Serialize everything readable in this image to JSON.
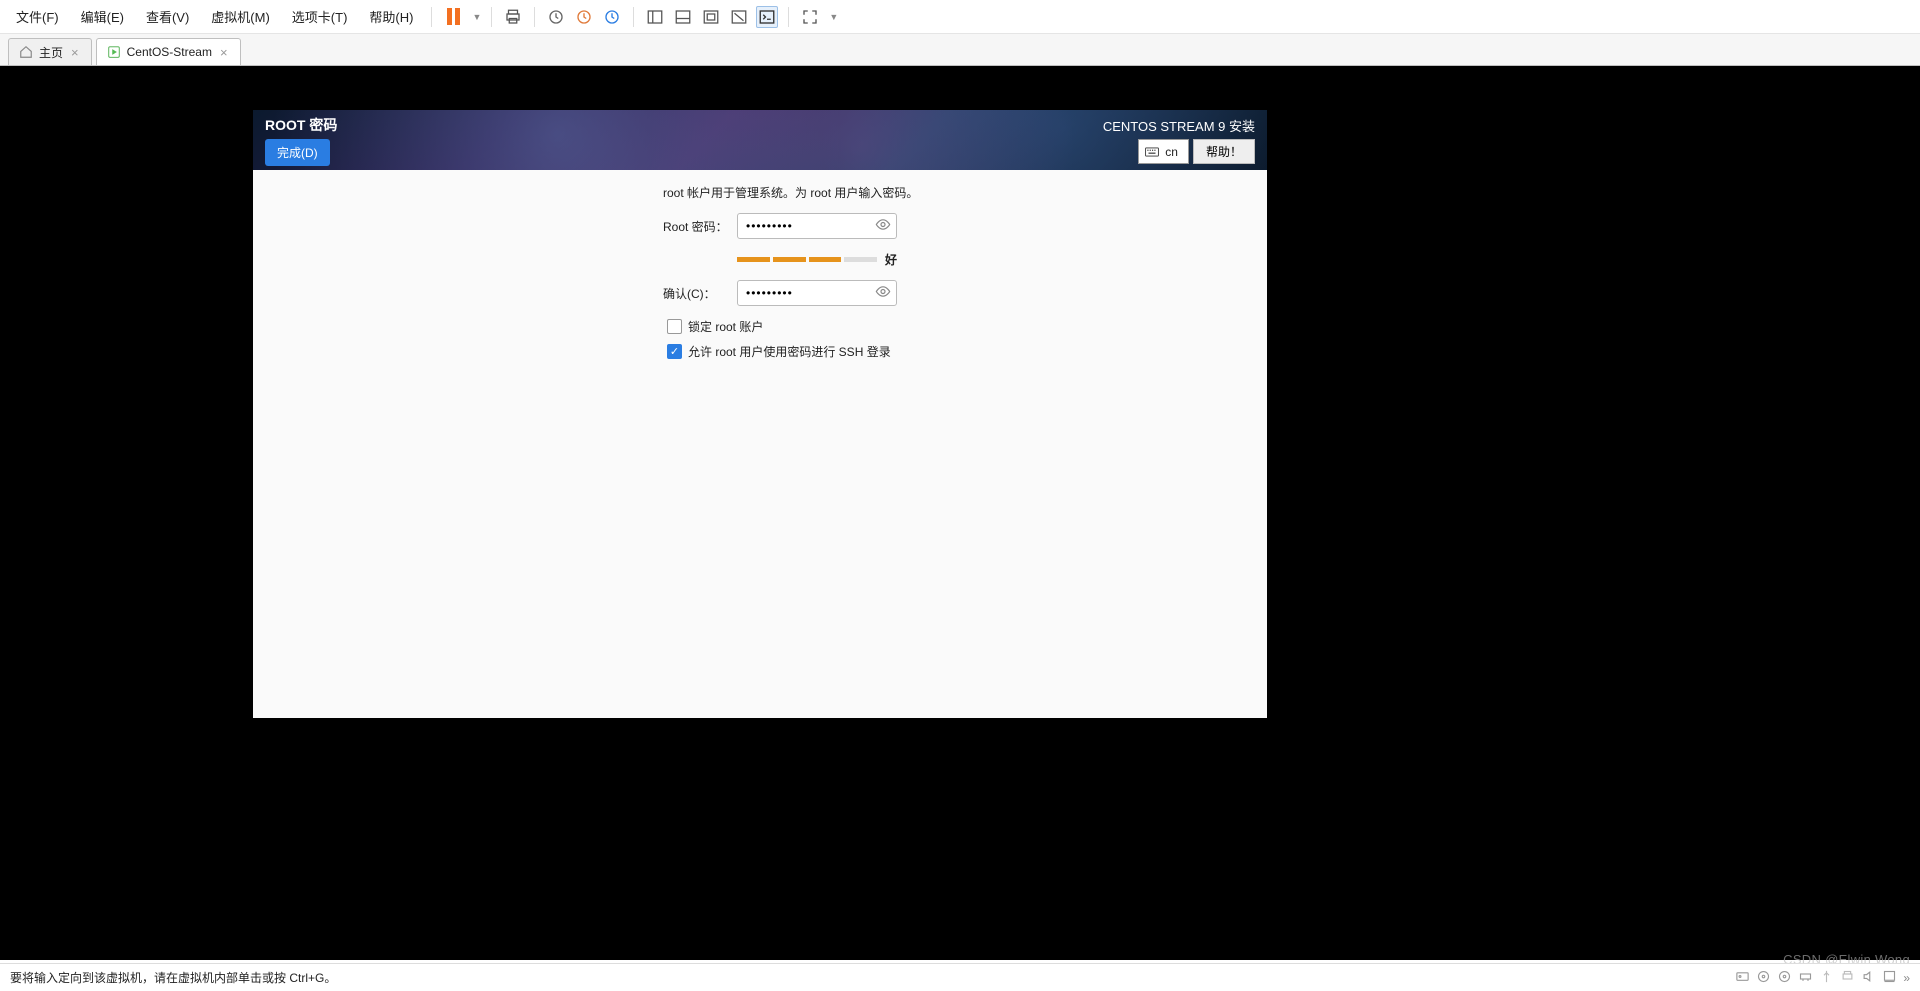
{
  "menubar": {
    "file": "文件(F)",
    "edit": "编辑(E)",
    "view": "查看(V)",
    "vm": "虚拟机(M)",
    "tabs": "选项卡(T)",
    "help": "帮助(H)"
  },
  "tabs": {
    "home": "主页",
    "vm_name": "CentOS-Stream"
  },
  "installer": {
    "title": "ROOT 密码",
    "done": "完成(D)",
    "install_title": "CENTOS STREAM 9 安装",
    "kb_layout": "cn",
    "help": "帮助！",
    "desc": "root 帐户用于管理系统。为 root 用户输入密码。",
    "pwd_label": "Root 密码：",
    "confirm_label": "确认(C)：",
    "pwd_value": "•••••••••",
    "confirm_value": "•••••••••",
    "strength_text": "好",
    "lock_label": "锁定 root 账户",
    "ssh_label": "允许 root 用户使用密码进行 SSH 登录"
  },
  "statusbar": {
    "hint": "要将输入定向到该虚拟机，请在虚拟机内部单击或按 Ctrl+G。"
  },
  "watermark": "CSDN @Elwin Wong"
}
